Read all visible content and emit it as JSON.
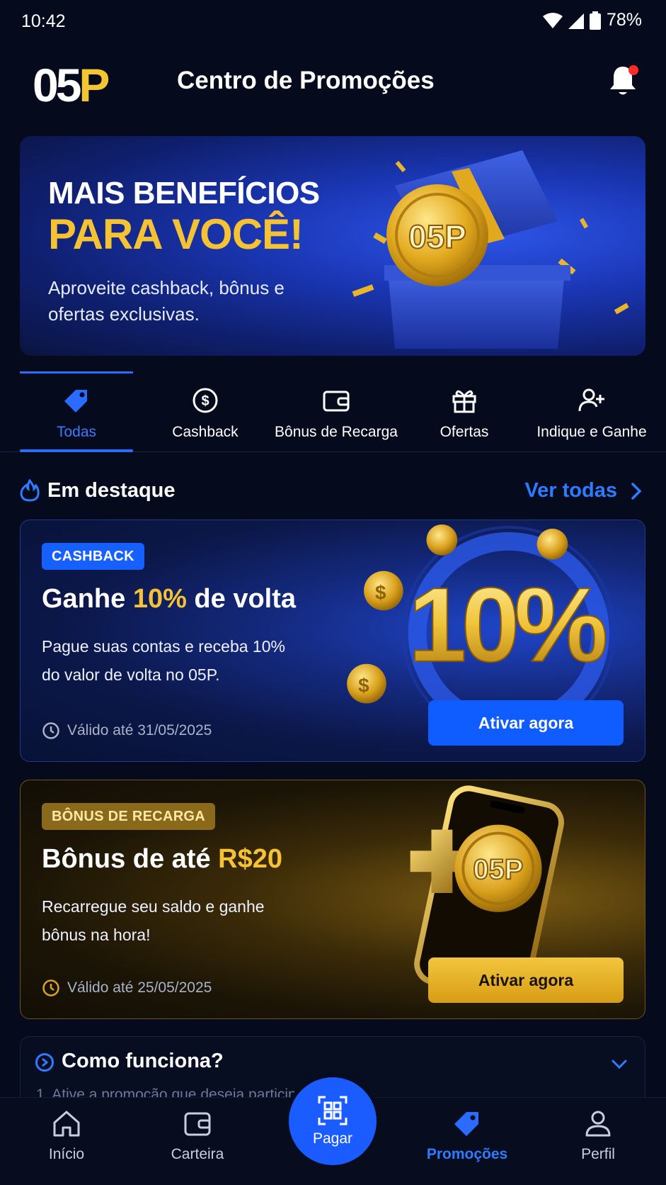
{
  "status_bar": {
    "time": "10:42",
    "battery": "78%"
  },
  "header": {
    "logo_white": "05",
    "logo_gold": "P",
    "title": "Centro de Promoções",
    "has_notification": true
  },
  "hero": {
    "line1": "MAIS BENEFÍCIOS",
    "line2": "PARA VOCÊ!",
    "subtitle": "Aproveite cashback, bônus e ofertas exclusivas.",
    "coin_text": "05P"
  },
  "tabs": [
    {
      "label": "Todas",
      "icon": "tag-icon",
      "active": true
    },
    {
      "label": "Cashback",
      "icon": "dollar-circle-icon",
      "active": false
    },
    {
      "label": "Bônus de Recarga",
      "icon": "wallet-icon",
      "active": false
    },
    {
      "label": "Ofertas",
      "icon": "gift-icon",
      "active": false
    },
    {
      "label": "Indique e Ganhe",
      "icon": "user-plus-icon",
      "active": false
    }
  ],
  "featured": {
    "title": "Em destaque",
    "see_all": "Ver todas"
  },
  "promos": [
    {
      "badge": "CASHBACK",
      "title_prefix": "Ganhe ",
      "title_highlight": "10%",
      "title_suffix": " de volta",
      "description": "Pague suas contas e receba 10% do valor de volta no 05P.",
      "valid_until": "Válido até 31/05/2025",
      "cta": "Ativar agora",
      "art_text": "10%"
    },
    {
      "badge": "BÔNUS DE RECARGA",
      "title_prefix": "Bônus de até ",
      "title_highlight": "R$20",
      "title_suffix": "",
      "description": "Recarregue seu saldo e ganhe bônus na hora!",
      "valid_until": "Válido até 25/05/2025",
      "cta": "Ativar agora",
      "art_text": "05P"
    }
  ],
  "how_it_works": {
    "title": "Como funciona?",
    "first_step": "1. Ative a promoção que deseja participar"
  },
  "bottom_nav": {
    "home": "Início",
    "wallet": "Carteira",
    "pay": "Pagar",
    "promotions": "Promoções",
    "profile": "Perfil",
    "active": "promotions"
  },
  "colors": {
    "background": "#050b1c",
    "accent_blue": "#2b6cff",
    "accent_gold": "#f5c233",
    "notification_dot": "#ff2b2b"
  }
}
